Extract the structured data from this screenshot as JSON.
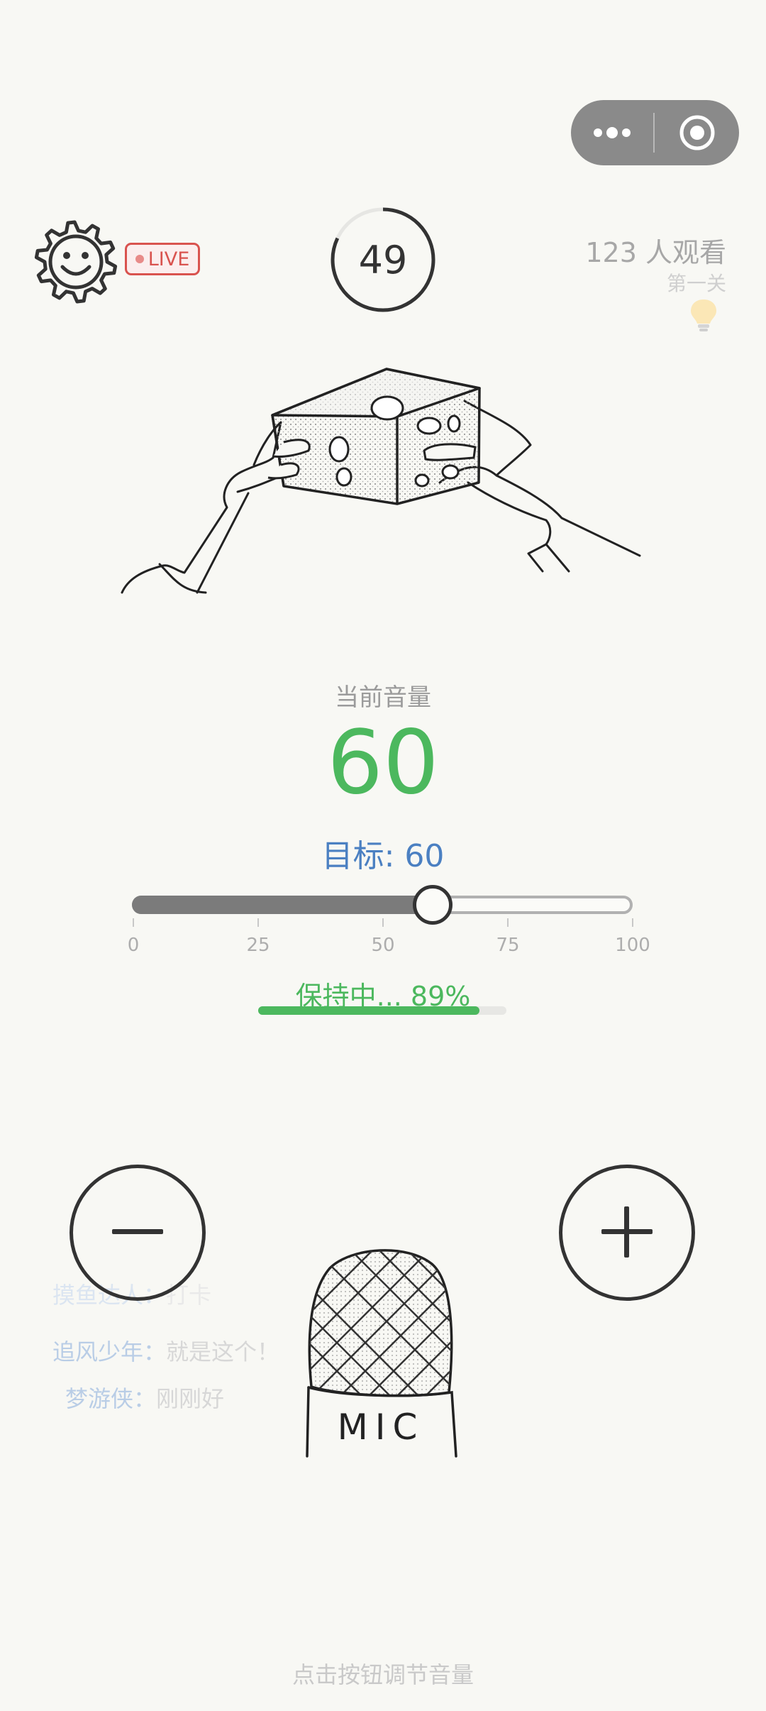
{
  "capsule": {
    "more_icon": "more-dots-icon",
    "close_icon": "record-target-icon"
  },
  "status": {
    "live_label": "LIVE",
    "countdown": "49",
    "countdown_progress": 0.82,
    "viewers": "123 人观看",
    "level": "第一关",
    "hint_icon": "lightbulb-icon"
  },
  "volume": {
    "label": "当前音量",
    "current": "60",
    "target_text": "目标: 60",
    "current_value": 60,
    "target_value": 60,
    "scale": [
      "0",
      "25",
      "50",
      "75",
      "100"
    ]
  },
  "hold": {
    "text": "保持中... 89%",
    "progress": 0.89
  },
  "controls": {
    "decrease_icon": "minus-icon",
    "increase_icon": "plus-icon"
  },
  "microphone": {
    "label": "MIC"
  },
  "comments": [
    {
      "name": "摸鱼达人：",
      "text": "打卡"
    },
    {
      "name": "追风少年：",
      "text": "就是这个！"
    },
    {
      "name": "梦游侠：",
      "text": "刚刚好"
    }
  ],
  "footer_hint": "点击按钮调节音量",
  "colors": {
    "accent_green": "#4cb85e",
    "target_blue": "#4b80c2",
    "live_red": "#d9534f",
    "background": "#f8f8f4"
  }
}
